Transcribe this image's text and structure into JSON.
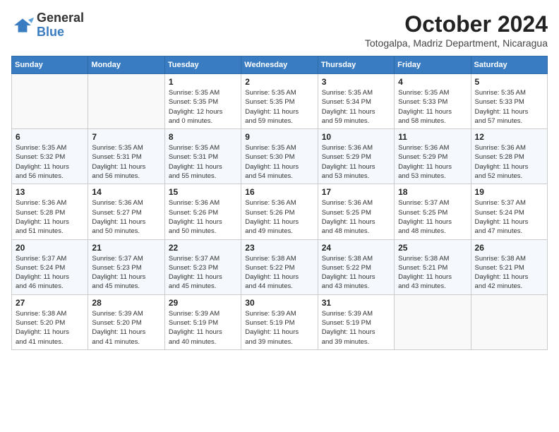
{
  "header": {
    "logo_general": "General",
    "logo_blue": "Blue",
    "title": "October 2024",
    "location": "Totogalpa, Madriz Department, Nicaragua"
  },
  "days_of_week": [
    "Sunday",
    "Monday",
    "Tuesday",
    "Wednesday",
    "Thursday",
    "Friday",
    "Saturday"
  ],
  "weeks": [
    [
      {
        "day": "",
        "info": ""
      },
      {
        "day": "",
        "info": ""
      },
      {
        "day": "1",
        "info": "Sunrise: 5:35 AM\nSunset: 5:35 PM\nDaylight: 12 hours\nand 0 minutes."
      },
      {
        "day": "2",
        "info": "Sunrise: 5:35 AM\nSunset: 5:35 PM\nDaylight: 11 hours\nand 59 minutes."
      },
      {
        "day": "3",
        "info": "Sunrise: 5:35 AM\nSunset: 5:34 PM\nDaylight: 11 hours\nand 59 minutes."
      },
      {
        "day": "4",
        "info": "Sunrise: 5:35 AM\nSunset: 5:33 PM\nDaylight: 11 hours\nand 58 minutes."
      },
      {
        "day": "5",
        "info": "Sunrise: 5:35 AM\nSunset: 5:33 PM\nDaylight: 11 hours\nand 57 minutes."
      }
    ],
    [
      {
        "day": "6",
        "info": "Sunrise: 5:35 AM\nSunset: 5:32 PM\nDaylight: 11 hours\nand 56 minutes."
      },
      {
        "day": "7",
        "info": "Sunrise: 5:35 AM\nSunset: 5:31 PM\nDaylight: 11 hours\nand 56 minutes."
      },
      {
        "day": "8",
        "info": "Sunrise: 5:35 AM\nSunset: 5:31 PM\nDaylight: 11 hours\nand 55 minutes."
      },
      {
        "day": "9",
        "info": "Sunrise: 5:35 AM\nSunset: 5:30 PM\nDaylight: 11 hours\nand 54 minutes."
      },
      {
        "day": "10",
        "info": "Sunrise: 5:36 AM\nSunset: 5:29 PM\nDaylight: 11 hours\nand 53 minutes."
      },
      {
        "day": "11",
        "info": "Sunrise: 5:36 AM\nSunset: 5:29 PM\nDaylight: 11 hours\nand 53 minutes."
      },
      {
        "day": "12",
        "info": "Sunrise: 5:36 AM\nSunset: 5:28 PM\nDaylight: 11 hours\nand 52 minutes."
      }
    ],
    [
      {
        "day": "13",
        "info": "Sunrise: 5:36 AM\nSunset: 5:28 PM\nDaylight: 11 hours\nand 51 minutes."
      },
      {
        "day": "14",
        "info": "Sunrise: 5:36 AM\nSunset: 5:27 PM\nDaylight: 11 hours\nand 50 minutes."
      },
      {
        "day": "15",
        "info": "Sunrise: 5:36 AM\nSunset: 5:26 PM\nDaylight: 11 hours\nand 50 minutes."
      },
      {
        "day": "16",
        "info": "Sunrise: 5:36 AM\nSunset: 5:26 PM\nDaylight: 11 hours\nand 49 minutes."
      },
      {
        "day": "17",
        "info": "Sunrise: 5:36 AM\nSunset: 5:25 PM\nDaylight: 11 hours\nand 48 minutes."
      },
      {
        "day": "18",
        "info": "Sunrise: 5:37 AM\nSunset: 5:25 PM\nDaylight: 11 hours\nand 48 minutes."
      },
      {
        "day": "19",
        "info": "Sunrise: 5:37 AM\nSunset: 5:24 PM\nDaylight: 11 hours\nand 47 minutes."
      }
    ],
    [
      {
        "day": "20",
        "info": "Sunrise: 5:37 AM\nSunset: 5:24 PM\nDaylight: 11 hours\nand 46 minutes."
      },
      {
        "day": "21",
        "info": "Sunrise: 5:37 AM\nSunset: 5:23 PM\nDaylight: 11 hours\nand 45 minutes."
      },
      {
        "day": "22",
        "info": "Sunrise: 5:37 AM\nSunset: 5:23 PM\nDaylight: 11 hours\nand 45 minutes."
      },
      {
        "day": "23",
        "info": "Sunrise: 5:38 AM\nSunset: 5:22 PM\nDaylight: 11 hours\nand 44 minutes."
      },
      {
        "day": "24",
        "info": "Sunrise: 5:38 AM\nSunset: 5:22 PM\nDaylight: 11 hours\nand 43 minutes."
      },
      {
        "day": "25",
        "info": "Sunrise: 5:38 AM\nSunset: 5:21 PM\nDaylight: 11 hours\nand 43 minutes."
      },
      {
        "day": "26",
        "info": "Sunrise: 5:38 AM\nSunset: 5:21 PM\nDaylight: 11 hours\nand 42 minutes."
      }
    ],
    [
      {
        "day": "27",
        "info": "Sunrise: 5:38 AM\nSunset: 5:20 PM\nDaylight: 11 hours\nand 41 minutes."
      },
      {
        "day": "28",
        "info": "Sunrise: 5:39 AM\nSunset: 5:20 PM\nDaylight: 11 hours\nand 41 minutes."
      },
      {
        "day": "29",
        "info": "Sunrise: 5:39 AM\nSunset: 5:19 PM\nDaylight: 11 hours\nand 40 minutes."
      },
      {
        "day": "30",
        "info": "Sunrise: 5:39 AM\nSunset: 5:19 PM\nDaylight: 11 hours\nand 39 minutes."
      },
      {
        "day": "31",
        "info": "Sunrise: 5:39 AM\nSunset: 5:19 PM\nDaylight: 11 hours\nand 39 minutes."
      },
      {
        "day": "",
        "info": ""
      },
      {
        "day": "",
        "info": ""
      }
    ]
  ]
}
